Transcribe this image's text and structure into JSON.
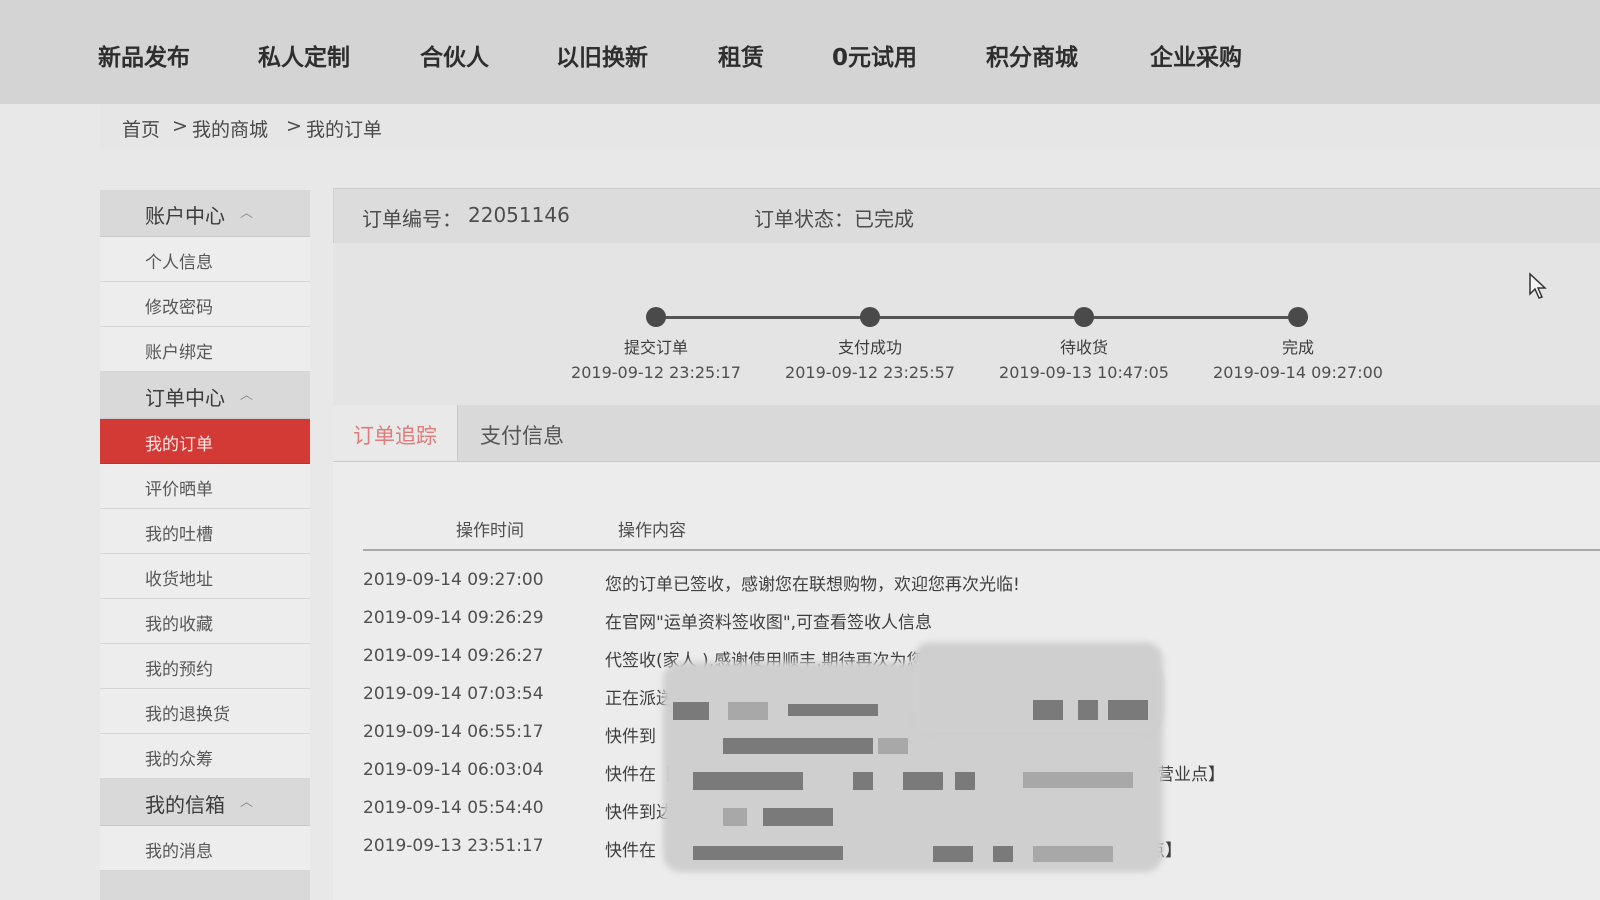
{
  "topnav": {
    "items": [
      {
        "label": "新品发布"
      },
      {
        "label": "私人定制"
      },
      {
        "label": "合伙人"
      },
      {
        "label": "以旧换新"
      },
      {
        "label": "租赁"
      },
      {
        "label": "0元试用"
      },
      {
        "label": "积分商城"
      },
      {
        "label": "企业采购"
      }
    ]
  },
  "breadcrumb": {
    "home": "首页",
    "sep": ">",
    "level2": "我的商城",
    "current": "我的订单"
  },
  "sidebar": {
    "account": {
      "title": "账户中心",
      "items": [
        "个人信息",
        "修改密码",
        "账户绑定"
      ]
    },
    "orders": {
      "title": "订单中心",
      "items": [
        "我的订单",
        "评价晒单",
        "我的吐槽",
        "收货地址",
        "我的收藏",
        "我的预约",
        "我的退换货",
        "我的众筹"
      ],
      "active": "我的订单"
    },
    "mailbox": {
      "title": "我的信箱",
      "items": [
        "我的消息"
      ]
    }
  },
  "order": {
    "number_label": "订单编号：",
    "number": "22051146",
    "status_label": "订单状态：",
    "status": "已完成"
  },
  "progress": {
    "steps": [
      {
        "label": "提交订单",
        "time": "2019-09-12 23:25:17"
      },
      {
        "label": "支付成功",
        "time": "2019-09-12 23:25:57"
      },
      {
        "label": "待收货",
        "time": "2019-09-13 10:47:05"
      },
      {
        "label": "完成",
        "time": "2019-09-14 09:27:00"
      }
    ]
  },
  "tabs": [
    {
      "label": "订单追踪",
      "active": true
    },
    {
      "label": "支付信息",
      "active": false
    }
  ],
  "tracking": {
    "col_time": "操作时间",
    "col_content": "操作内容",
    "rows": [
      {
        "time": "2019-09-14 09:27:00",
        "text": "您的订单已签收，感谢您在联想购物，欢迎您再次光临!"
      },
      {
        "time": "2019-09-14 09:26:29",
        "text": "在官网\"运单资料签收图\",可查看签收人信息"
      },
      {
        "time": "2019-09-14 09:26:27",
        "text": "代签收(家人 ),感谢使用顺丰,期待再次为您服务"
      },
      {
        "time": "2019-09-14 07:03:54",
        "text": "正在派送途中,请您准备签收(派件人:"
      },
      {
        "time": "2019-09-14 06:55:17",
        "text": "快件到",
        "tail": "]"
      },
      {
        "time": "2019-09-14 06:03:04",
        "text": "快件在【",
        "tail": "营业点】"
      },
      {
        "time": "2019-09-14 05:54:40",
        "text": "快件到达"
      },
      {
        "time": "2019-09-13 23:51:17",
        "text": "快件在",
        "tail": "散点】"
      }
    ]
  }
}
